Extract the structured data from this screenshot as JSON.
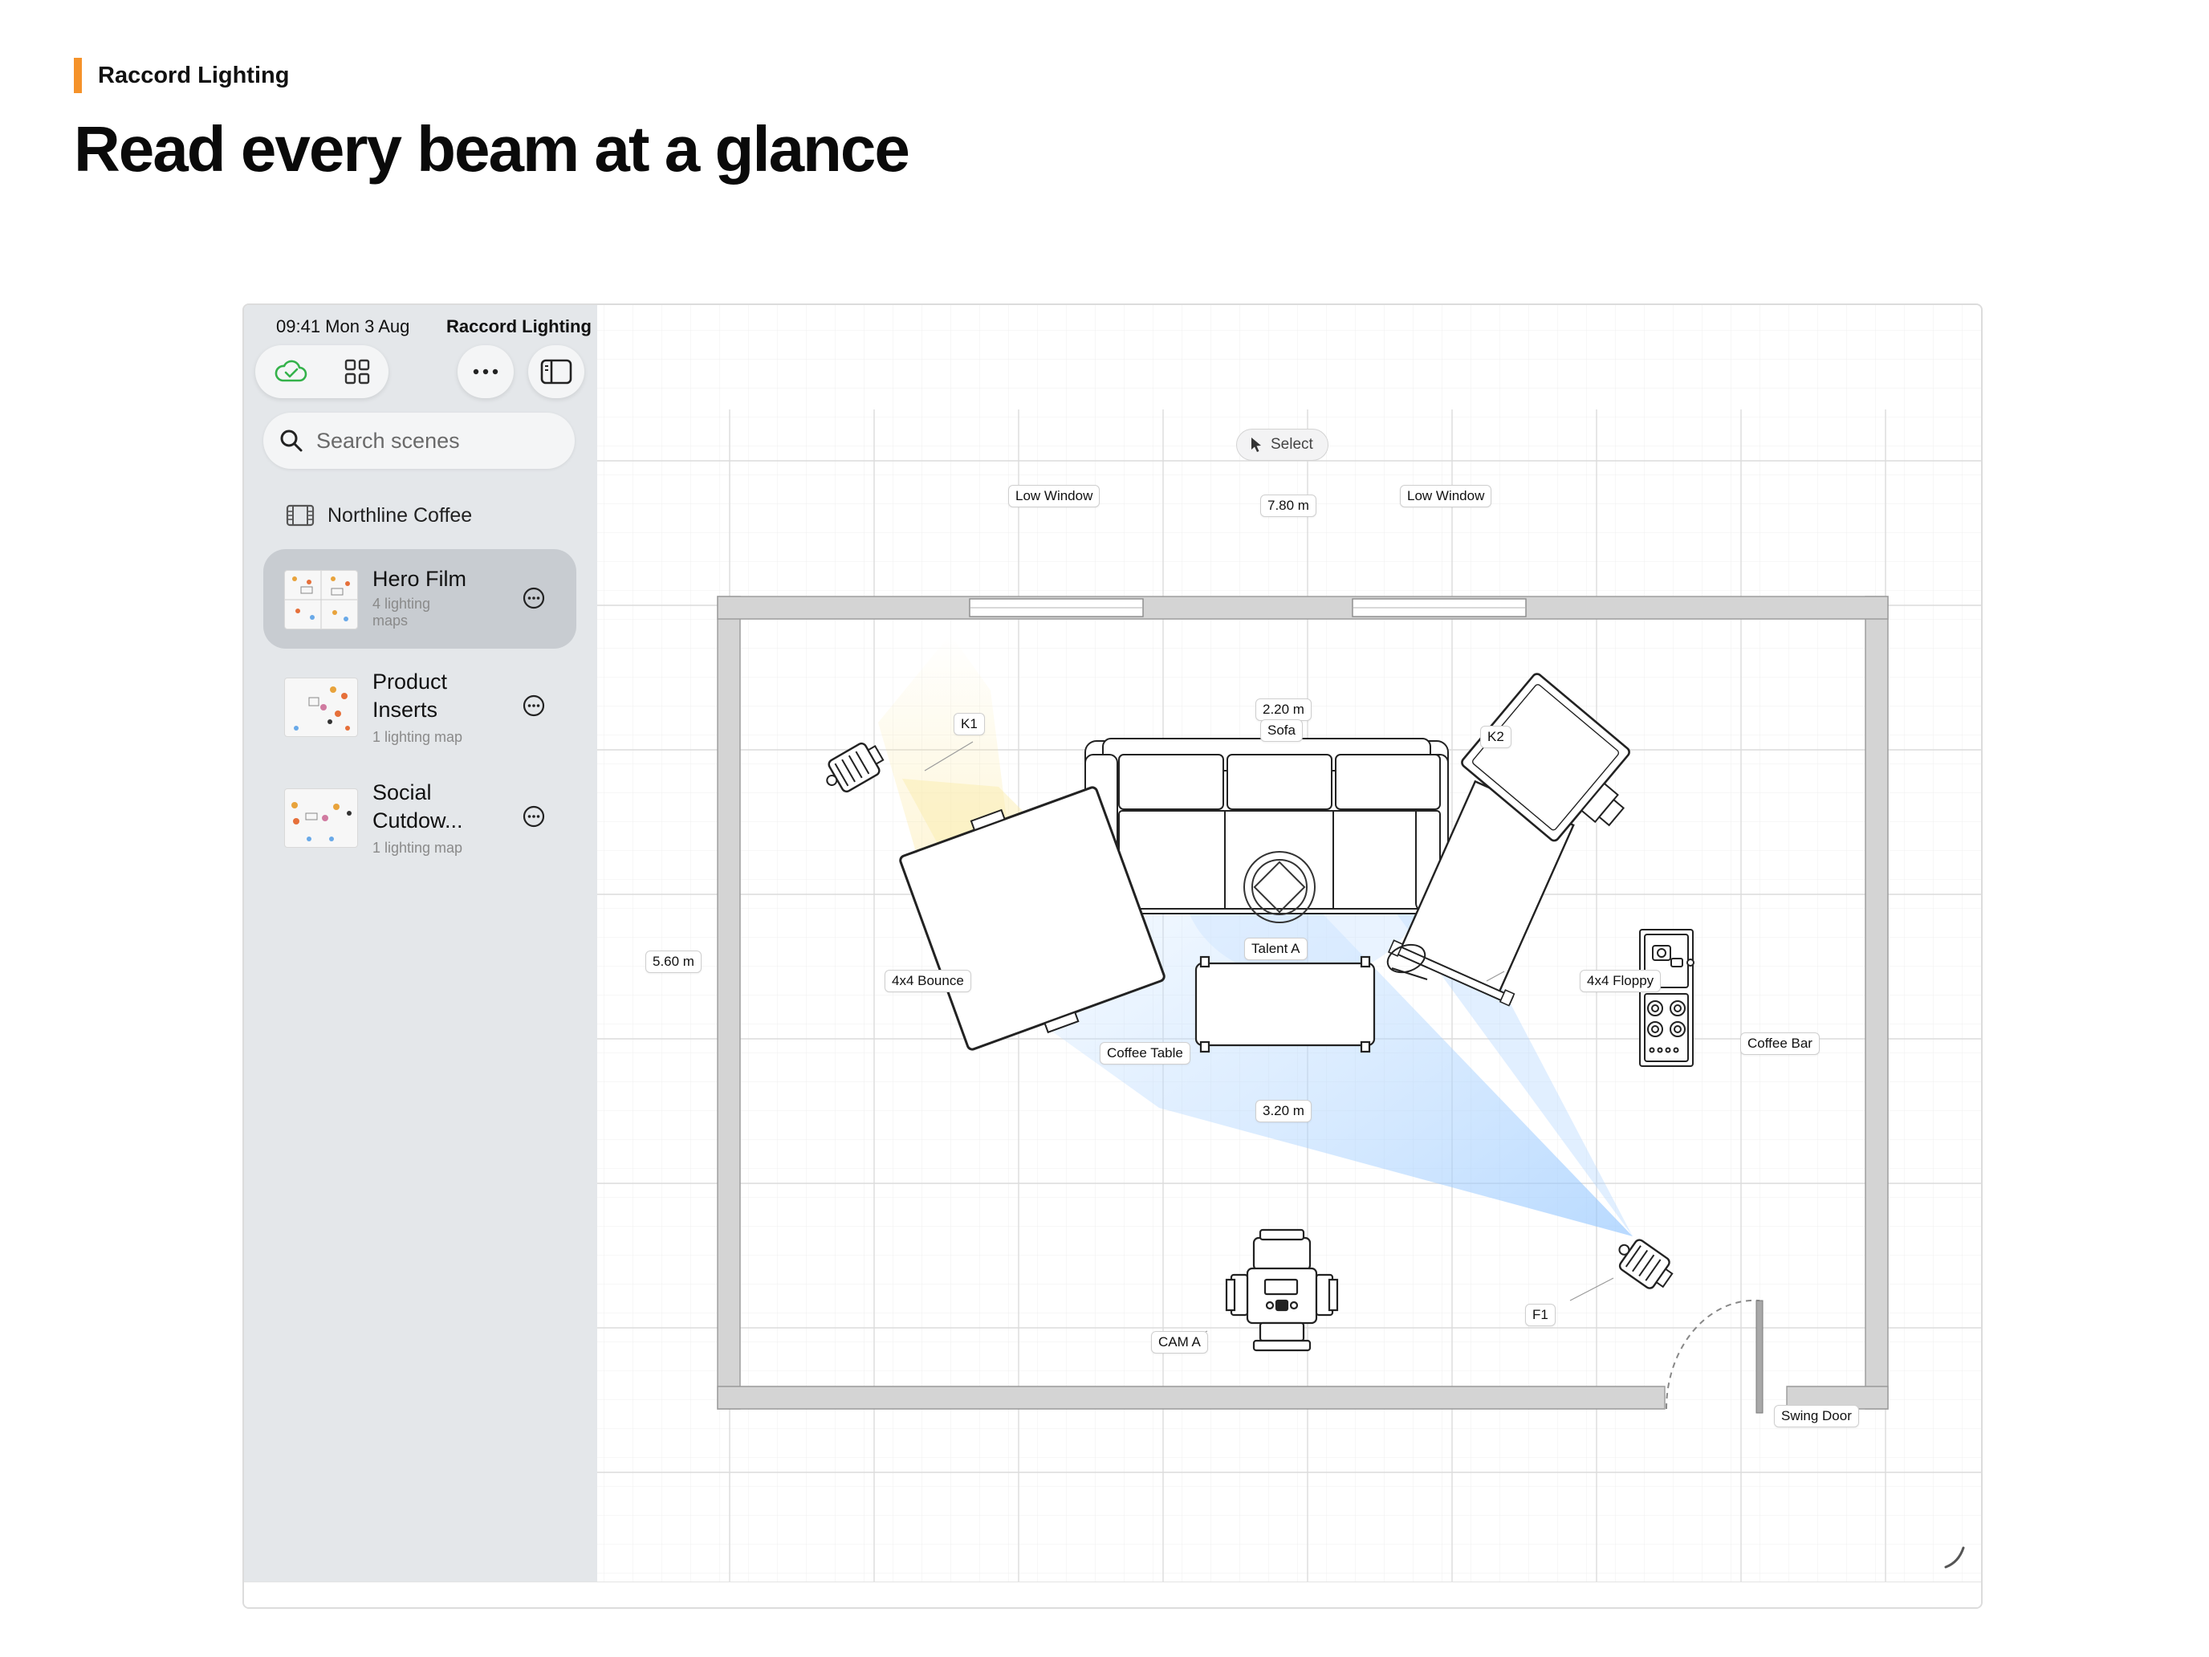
{
  "brand": {
    "name": "Raccord Lighting",
    "accent_color": "#f5922a"
  },
  "headline": "Read every beam at a glance",
  "status_bar": {
    "time": "09:41 Mon 3 Aug",
    "app_name": "Raccord Lighting",
    "icons": [
      "cellular-icon",
      "wifi-icon",
      "battery-charging-icon"
    ]
  },
  "toolbar": {
    "icons": [
      "cloud-synced-icon",
      "grid-view-icon",
      "more-icon",
      "sidebar-toggle-icon"
    ]
  },
  "search": {
    "placeholder": "Search scenes"
  },
  "project": {
    "name": "Northline Coffee"
  },
  "scenes": [
    {
      "title": "Hero Film",
      "subtitle": "4 lighting maps",
      "selected": true
    },
    {
      "title": "Product Inserts",
      "subtitle": "1 lighting map",
      "selected": false
    },
    {
      "title": "Social Cutdow...",
      "subtitle": "1 lighting map",
      "selected": false
    }
  ],
  "floorplan": {
    "select_tool": "Select",
    "labels": {
      "low_window_left": "Low Window",
      "low_window_right": "Low Window",
      "width": "7.80 m",
      "depth": "5.60 m",
      "sofa_width": "2.20 m",
      "sofa": "Sofa",
      "k1": "K1",
      "k2": "K2",
      "talent": "Talent A",
      "bounce": "4x4 Bounce",
      "floppy": "4x4 Floppy",
      "coffee_table": "Coffee Table",
      "coffee_bar": "Coffee Bar",
      "throw_distance": "3.20 m",
      "cam": "CAM A",
      "f1": "F1",
      "door": "Swing Door"
    }
  }
}
